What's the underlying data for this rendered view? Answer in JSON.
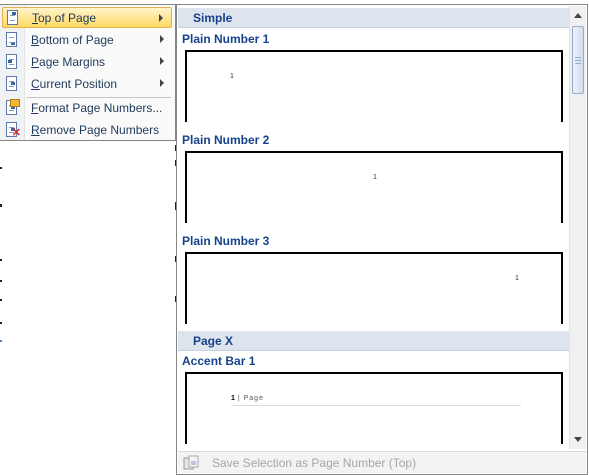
{
  "menu": {
    "items": [
      {
        "label": "Top of Page",
        "icon": "page-top-icon",
        "submenu": true,
        "highlighted": true
      },
      {
        "label": "Bottom of Page",
        "icon": "page-bottom-icon",
        "submenu": true
      },
      {
        "label": "Page Margins",
        "icon": "page-margins-icon",
        "submenu": true
      },
      {
        "label": "Current Position",
        "icon": "current-position-icon",
        "submenu": true
      },
      {
        "label": "Format Page Numbers...",
        "icon": "format-page-numbers-icon",
        "submenu": false
      },
      {
        "label": "Remove Page Numbers",
        "icon": "remove-page-numbers-icon",
        "submenu": false
      }
    ]
  },
  "gallery": {
    "sections": [
      {
        "header": "Simple"
      },
      {
        "header": "Page X"
      }
    ],
    "entries": [
      {
        "label": "Plain Number 1",
        "number": "1"
      },
      {
        "label": "Plain Number 2",
        "number": "1"
      },
      {
        "label": "Plain Number 3",
        "number": "1"
      },
      {
        "label": "Accent Bar 1",
        "number": "1",
        "suffix": "Page"
      }
    ],
    "footer": {
      "label": "Save Selection as Page Number (Top)",
      "enabled": false
    }
  },
  "colors": {
    "highlight": "#ffd963",
    "header_bg": "#dde4ee",
    "text": "#15428b",
    "disabled_text": "#a6a6a6"
  }
}
